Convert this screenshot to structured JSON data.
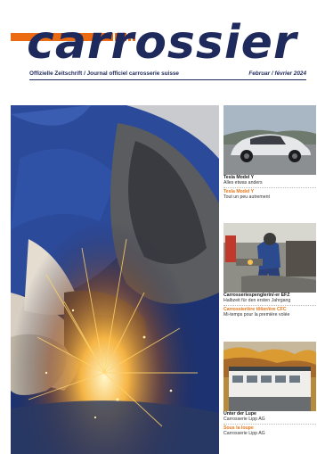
{
  "masthead": {
    "logo": "carrossier",
    "subtitle_left": "Offizielle Zeitschrift / Journal officiel carrosserie suisse",
    "issue": "Februar / février 2024"
  },
  "colors": {
    "navy": "#1f2a5c",
    "orange": "#ec6a12",
    "caption_orange": "#e8771a"
  },
  "articles": [
    {
      "de_title": "Tesla Model Y",
      "de_sub": "Alles etwas anders",
      "fr_title": "Tesla Model Y",
      "fr_sub": "Tout un peu autrement"
    },
    {
      "de_title": "Carrosseriespenglerin/-er EFZ",
      "de_sub": "Halbzeit für den ersten Jahrgang",
      "fr_title": "Carrossier/ère tôlier/ère CFC",
      "fr_sub": "Mi-temps pour la première volée"
    },
    {
      "de_title": "Unter der Lupe",
      "de_sub": "Carrosserie Lipp AG",
      "fr_title": "Sous la loupe",
      "fr_sub": "Carrosserie Lipp AG"
    }
  ]
}
